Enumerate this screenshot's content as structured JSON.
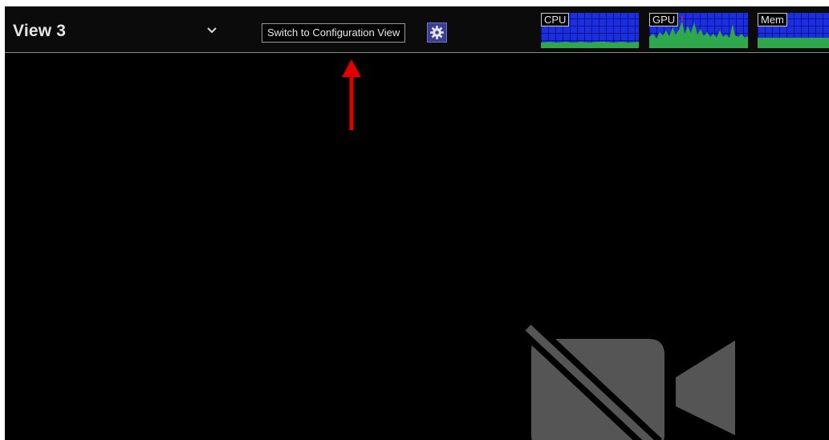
{
  "header": {
    "view_title": "View 3",
    "switch_button_label": "Switch to Configuration View",
    "dropdown_icon": "chevron-down-icon",
    "settings_icon": "gear-icon"
  },
  "monitors": [
    {
      "label": "CPU",
      "fill_color": "#2ea84a",
      "level": 0.2
    },
    {
      "label": "GPU",
      "fill_color": "#2ea84a",
      "level": 0.45
    },
    {
      "label": "Mem",
      "fill_color": "#2ea84a",
      "level": 0.35
    }
  ],
  "main": {
    "placeholder_icon": "video-off-icon"
  },
  "annotation": {
    "arrow_color": "#e10000"
  },
  "colors": {
    "background": "#000000",
    "monitor_grid": "#1b2fe0",
    "gear_button": "#3b3f8f",
    "placeholder_icon": "#555555"
  }
}
